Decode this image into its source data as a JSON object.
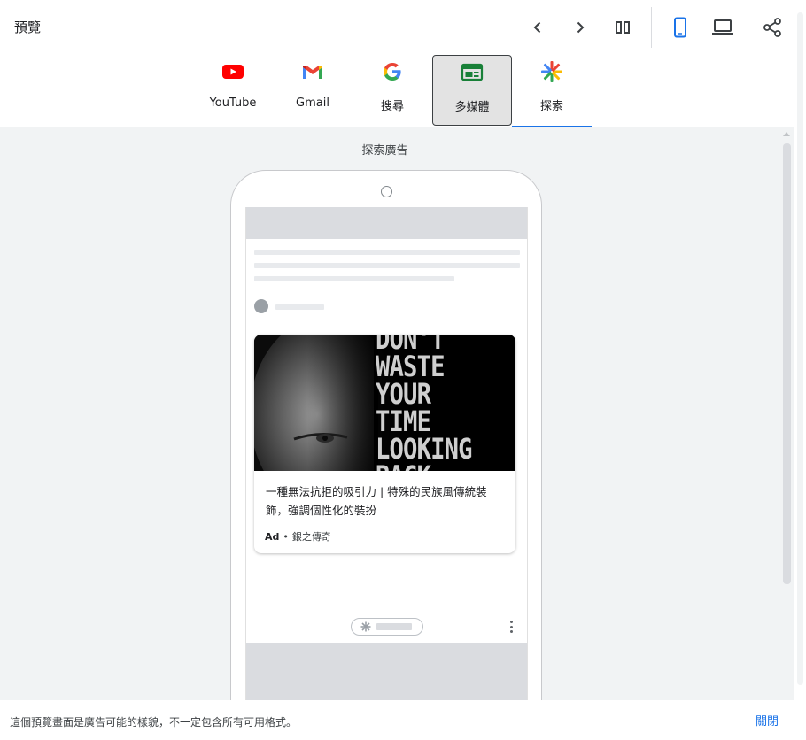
{
  "header": {
    "title": "預覽"
  },
  "tabs": [
    {
      "label": "YouTube",
      "icon": "youtube-icon"
    },
    {
      "label": "Gmail",
      "icon": "gmail-icon"
    },
    {
      "label": "搜尋",
      "icon": "google-search-icon"
    },
    {
      "label": "多媒體",
      "icon": "display-icon"
    },
    {
      "label": "探索",
      "icon": "discover-icon"
    }
  ],
  "preview": {
    "label": "探索廣告",
    "ad": {
      "headline": "一種無法抗拒的吸引力 | 特殊的民族風傳統裝飾，強調個性化的裝扮",
      "badge": "Ad",
      "separator": "•",
      "advertiser": "銀之傳奇",
      "image_text": [
        "DON'T",
        "WASTE",
        "YOUR",
        "TIME",
        "LOOKING",
        "BACK"
      ]
    }
  },
  "footer": {
    "disclaimer": "這個預覽畫面是廣告可能的樣貌，不一定包含所有可用格式。",
    "close_label": "關閉"
  },
  "colors": {
    "accent": "#1a73e8",
    "youtube_red": "#ff0000",
    "display_green": "#188038"
  }
}
